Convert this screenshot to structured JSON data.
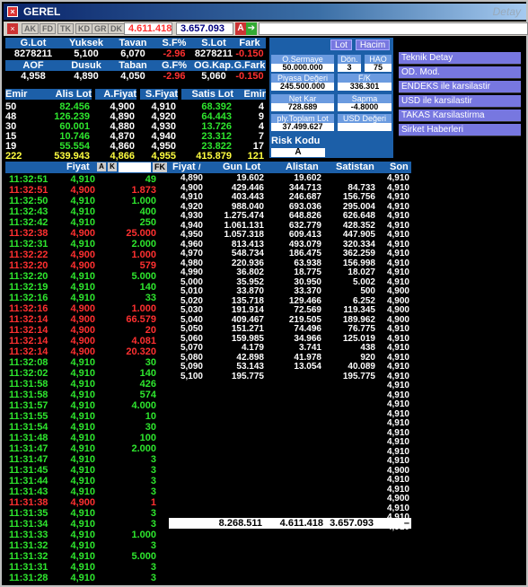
{
  "window": {
    "title": "GEREL",
    "right_label": "Detay"
  },
  "toolbar": {
    "tabs": [
      "AK",
      "FD",
      "TK",
      "KD",
      "GR",
      "DK"
    ],
    "value1": "4.611.418",
    "value2": "3.657.093",
    "a_label": "A"
  },
  "summary": {
    "row1_headers": [
      "G.Lot",
      "Yuksek",
      "Tavan",
      "S.F%",
      "S.Lot",
      "Fark"
    ],
    "row1_values": [
      "8278211",
      "5,100",
      "6,070",
      "-2.96",
      "8278211",
      "-0.150"
    ],
    "row2_headers": [
      "AOF",
      "Dusuk",
      "Taban",
      "G.F%",
      "OG.Kap.",
      "G.Fark"
    ],
    "row2_values": [
      "4,958",
      "4,890",
      "4,050",
      "-2.96",
      "5,060",
      "-0.150"
    ]
  },
  "depth": {
    "headers": [
      "Emir",
      "Alis Lot",
      "A.Fiyat",
      "S.Fiyat",
      "Satis Lot",
      "Emir"
    ],
    "rows": [
      [
        "50",
        "82.456",
        "4,900",
        "4,910",
        "68.392",
        "4"
      ],
      [
        "48",
        "126.239",
        "4,890",
        "4,920",
        "64.443",
        "9"
      ],
      [
        "30",
        "60.001",
        "4,880",
        "4,930",
        "13.726",
        "4"
      ],
      [
        "15",
        "10.746",
        "4,870",
        "4,940",
        "23.312",
        "7"
      ],
      [
        "19",
        "55.554",
        "4,860",
        "4,950",
        "23.822",
        "17"
      ],
      [
        "222",
        "539.943",
        "4,866",
        "4,955",
        "415.879",
        "121"
      ]
    ]
  },
  "panel": {
    "btn_lot": "Lot",
    "btn_hacim": "Hacim",
    "osermaye_label": "O.Sermaye",
    "osermaye_value": "50.000.000",
    "don_label": "Dön.",
    "don_value": "3",
    "hao_label": "HAO",
    "hao_value": "75",
    "piyasa_label": "Piyasa Değeri",
    "piyasa_value": "245.500.000",
    "fk_label": "F/K",
    "fk_value": "336.301",
    "netkar_label": "Net Kar",
    "netkar_value": "728.689",
    "sapma_label": "Sapma",
    "sapma_value": "-4.8000",
    "ply_label": "ply.Toplam Lot",
    "ply_value": "37.499.627",
    "usd_label": "USD Değeri",
    "risk_label": "Risk Kodu",
    "risk_value": "A"
  },
  "right_menu": [
    "Teknik Detay",
    "OD. Mod.",
    "ENDEKS ile karsilastir",
    "USD ile karsilastir",
    "TAKAS Karsilastirma",
    "Sirket Haberleri"
  ],
  "trades": {
    "headers": {
      "fiyat": "Fiyat",
      "lot": "Lot"
    },
    "tag_a": "A",
    "tag_k": "K",
    "tag_fk": "FK",
    "rows": [
      [
        "11:32:51",
        "4,910",
        "49",
        "g"
      ],
      [
        "11:32:51",
        "4,900",
        "1.873",
        "r"
      ],
      [
        "11:32:50",
        "4,910",
        "1.000",
        "g"
      ],
      [
        "11:32:43",
        "4,910",
        "400",
        "g"
      ],
      [
        "11:32:42",
        "4,910",
        "250",
        "g"
      ],
      [
        "11:32:38",
        "4,900",
        "25.000",
        "r"
      ],
      [
        "11:32:31",
        "4,910",
        "2.000",
        "g"
      ],
      [
        "11:32:22",
        "4,900",
        "1.000",
        "r"
      ],
      [
        "11:32:20",
        "4,900",
        "579",
        "r"
      ],
      [
        "11:32:20",
        "4,910",
        "5.000",
        "g"
      ],
      [
        "11:32:19",
        "4,910",
        "140",
        "g"
      ],
      [
        "11:32:16",
        "4,910",
        "33",
        "g"
      ],
      [
        "11:32:16",
        "4,900",
        "1.000",
        "r"
      ],
      [
        "11:32:14",
        "4,900",
        "66.579",
        "r"
      ],
      [
        "11:32:14",
        "4,900",
        "20",
        "r"
      ],
      [
        "11:32:14",
        "4,900",
        "4.081",
        "r"
      ],
      [
        "11:32:14",
        "4,900",
        "20.320",
        "r"
      ],
      [
        "11:32:08",
        "4,910",
        "30",
        "g"
      ],
      [
        "11:32:02",
        "4,910",
        "140",
        "g"
      ],
      [
        "11:31:58",
        "4,910",
        "426",
        "g"
      ],
      [
        "11:31:58",
        "4,910",
        "574",
        "g"
      ],
      [
        "11:31:57",
        "4,910",
        "4.000",
        "g"
      ],
      [
        "11:31:55",
        "4,910",
        "10",
        "g"
      ],
      [
        "11:31:54",
        "4,910",
        "30",
        "g"
      ],
      [
        "11:31:48",
        "4,910",
        "100",
        "g"
      ],
      [
        "11:31:47",
        "4,910",
        "2.000",
        "g"
      ],
      [
        "11:31:47",
        "4,910",
        "3",
        "g"
      ],
      [
        "11:31:45",
        "4,910",
        "3",
        "g"
      ],
      [
        "11:31:44",
        "4,910",
        "3",
        "g"
      ],
      [
        "11:31:43",
        "4,910",
        "3",
        "g"
      ],
      [
        "11:31:38",
        "4,900",
        "1",
        "r"
      ],
      [
        "11:31:35",
        "4,910",
        "3",
        "g"
      ],
      [
        "11:31:34",
        "4,910",
        "3",
        "g"
      ],
      [
        "11:31:33",
        "4,910",
        "1.000",
        "g"
      ],
      [
        "11:31:32",
        "4,910",
        "3",
        "g"
      ],
      [
        "11:31:32",
        "4,910",
        "5.000",
        "g"
      ],
      [
        "11:31:31",
        "4,910",
        "3",
        "g"
      ],
      [
        "11:31:28",
        "4,910",
        "3",
        "g"
      ]
    ]
  },
  "levels": {
    "headers": [
      "Fiyat",
      "Gun Lot",
      "Alistan",
      "Satistan",
      "Son"
    ],
    "rows": [
      [
        "4,890",
        "19.602",
        "19.602",
        "",
        "4,910"
      ],
      [
        "4,900",
        "429.446",
        "344.713",
        "84.733",
        "4,910"
      ],
      [
        "4,910",
        "403.443",
        "246.687",
        "156.756",
        "4,910"
      ],
      [
        "4,920",
        "988.040",
        "693.036",
        "295.004",
        "4,910"
      ],
      [
        "4,930",
        "1.275.474",
        "648.826",
        "626.648",
        "4,910"
      ],
      [
        "4,940",
        "1.061.131",
        "632.779",
        "428.352",
        "4,910"
      ],
      [
        "4,950",
        "1.057.318",
        "609.413",
        "447.905",
        "4,910"
      ],
      [
        "4,960",
        "813.413",
        "493.079",
        "320.334",
        "4,910"
      ],
      [
        "4,970",
        "548.734",
        "186.475",
        "362.259",
        "4,910"
      ],
      [
        "4,980",
        "220.936",
        "63.938",
        "156.998",
        "4,910"
      ],
      [
        "4,990",
        "36.802",
        "18.775",
        "18.027",
        "4,910"
      ],
      [
        "5,000",
        "35.952",
        "30.950",
        "5.002",
        "4,910"
      ],
      [
        "5,010",
        "33.870",
        "33.370",
        "500",
        "4,900"
      ],
      [
        "5,020",
        "135.718",
        "129.466",
        "6.252",
        "4,900"
      ],
      [
        "5,030",
        "191.914",
        "72.569",
        "119.345",
        "4,900"
      ],
      [
        "5,040",
        "409.467",
        "219.505",
        "189.962",
        "4,900"
      ],
      [
        "5,050",
        "151.271",
        "74.496",
        "76.775",
        "4,910"
      ],
      [
        "5,060",
        "159.985",
        "34.966",
        "125.019",
        "4,910"
      ],
      [
        "5,070",
        "4.179",
        "3.741",
        "438",
        "4,910"
      ],
      [
        "5,080",
        "42.898",
        "41.978",
        "920",
        "4,910"
      ],
      [
        "5,090",
        "53.143",
        "13.054",
        "40.089",
        "4,910"
      ],
      [
        "5,100",
        "195.775",
        "",
        "195.775",
        "4,910"
      ]
    ],
    "extra_son": [
      "4,910",
      "4,910",
      "4,910",
      "4,910",
      "4,910",
      "4,910",
      "4,910",
      "4,910",
      "4,910",
      "4,900",
      "4,910",
      "4,910",
      "4,900",
      "4,910",
      "4,910",
      "4,910"
    ],
    "totals": [
      "8.268.511",
      "4.611.418",
      "3.657.093",
      "–"
    ]
  }
}
